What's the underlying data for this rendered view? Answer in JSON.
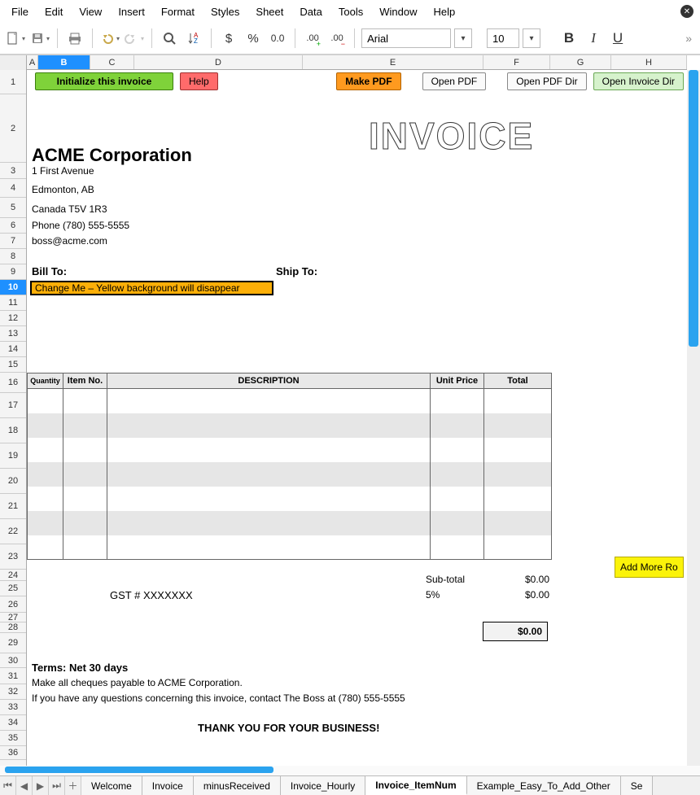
{
  "menu": {
    "items": [
      "File",
      "Edit",
      "View",
      "Insert",
      "Format",
      "Styles",
      "Sheet",
      "Data",
      "Tools",
      "Window",
      "Help"
    ]
  },
  "toolbar": {
    "font_name": "Arial",
    "font_size": "10"
  },
  "columns": {
    "widths": {
      "A": 14,
      "B": 64,
      "C": 54,
      "D": 207,
      "E": 222,
      "F": 82,
      "G": 75,
      "H": 85
    },
    "selected": "B",
    "labels": [
      "A",
      "B",
      "C",
      "D",
      "E",
      "F",
      "G",
      "H"
    ]
  },
  "rows": {
    "selected": 10,
    "heights": {
      "1": 30,
      "2": 84,
      "3": 20,
      "4": 23,
      "5": 25,
      "6": 19,
      "7": 19,
      "8": 19,
      "9": 19,
      "10": 19,
      "11": 19,
      "12": 19,
      "13": 19,
      "14": 19,
      "15": 19,
      "16": 25,
      "17": 31,
      "18": 31,
      "19": 31,
      "20": 31,
      "21": 31,
      "22": 31,
      "23": 31,
      "24": 14,
      "25": 19,
      "26": 20,
      "27": 12,
      "28": 13,
      "29": 25,
      "30": 18,
      "31": 20,
      "32": 19,
      "33": 19,
      "34": 19,
      "35": 19,
      "36": 17
    }
  },
  "buttons": {
    "init": "Initialize this invoice",
    "help": "Help",
    "make_pdf": "Make PDF",
    "open_pdf": "Open PDF",
    "open_pdf_dir": "Open PDF Dir",
    "open_invoice_dir": "Open Invoice Dir",
    "add_rows": "Add More Ro"
  },
  "company": {
    "name": "ACME Corporation",
    "addr1": "1 First Avenue",
    "addr2": "Edmonton, AB",
    "addr3": "Canada T5V 1R3",
    "phone": "Phone (780) 555-5555",
    "email": "boss@acme.com"
  },
  "invoice_title": "INVOICE",
  "labels": {
    "bill_to": "Bill To:",
    "ship_to": "Ship To:",
    "change_me": "Change Me – Yellow background will disappear",
    "qty": "Quantity",
    "itemno": "Item No.",
    "desc": "DESCRIPTION",
    "unitprice": "Unit Price",
    "total": "Total",
    "subtotal": "Sub-total",
    "taxpct": "5%",
    "gst": "GST # XXXXXXX",
    "terms": "Terms: Net 30 days",
    "payable": "Make all cheques payable to ACME Corporation.",
    "questions": "If you have any questions concerning this invoice, contact The Boss at (780) 555-5555",
    "thankyou": "THANK YOU FOR YOUR BUSINESS!",
    "zero": "$0.00"
  },
  "tabs": {
    "items": [
      "Welcome",
      "Invoice",
      "minusReceived",
      "Invoice_Hourly",
      "Invoice_ItemNum",
      "Example_Easy_To_Add_Other",
      "Se"
    ],
    "active": "Invoice_ItemNum"
  }
}
